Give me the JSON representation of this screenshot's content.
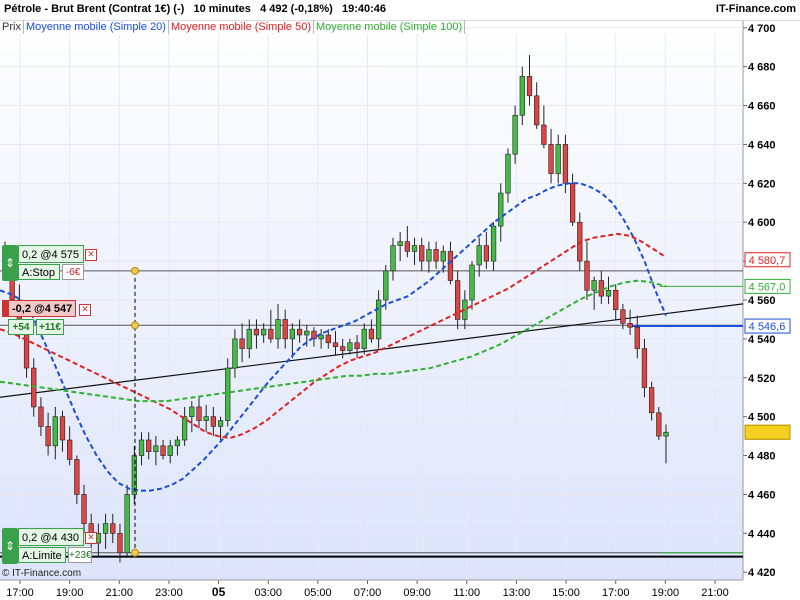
{
  "header": {
    "title": "Pétrole - Brut Brent (Contrat 1€) (-)   10 minutes   4 492 (-0,18%)   19:40:46",
    "brand": "IT-Finance.com"
  },
  "legend": [
    {
      "label": "Prix",
      "color": "#333333"
    },
    {
      "label": "Moyenne mobile (Simple 20)",
      "color": "#1a4fd8"
    },
    {
      "label": "Moyenne mobile (Simple 50)",
      "color": "#e02020"
    },
    {
      "label": "Moyenne mobile (Simple 100)",
      "color": "#30b030"
    }
  ],
  "footer": {
    "copyright": "© IT-Finance.com"
  },
  "orders": {
    "stop": {
      "line1": "0,2 @4 575",
      "line2": "A:Stop",
      "pnl": "-6€",
      "price": 4575
    },
    "position": {
      "line1": "-0,2 @4 547",
      "pnl1": "+54",
      "pnl2": "+11€",
      "price": 4547
    },
    "limit": {
      "line1": "0,2 @4 430",
      "line2": "A:Limite",
      "pnl": "+23€",
      "price": 4430
    }
  },
  "price_tags": [
    {
      "text": "4 580,7",
      "value": 4580.7,
      "color": "#e02020"
    },
    {
      "text": "4 567,0",
      "value": 4567.0,
      "color": "#30b030"
    },
    {
      "text": "4 546,6",
      "value": 4546.6,
      "color": "#1a4fd8"
    },
    {
      "text": "4 492",
      "value": 4492,
      "color": "#e8c000"
    }
  ],
  "colors": {
    "up": "#44bb44",
    "down": "#dd4444",
    "bg_top": "#ffffff",
    "bg_bottom": "#dde4fa"
  },
  "chart_data": {
    "type": "candlestick",
    "x_ticks": [
      "17:00",
      "19:00",
      "21:00",
      "23:00",
      "05",
      "03:00",
      "05:00",
      "07:00",
      "09:00",
      "11:00",
      "13:00",
      "15:00",
      "17:00",
      "19:00",
      "21:00"
    ],
    "y_ticks": [
      "4 420",
      "4 440",
      "4 460",
      "4 480",
      "4 500",
      "4 520",
      "4 540",
      "4 560",
      "4 580",
      "4 600",
      "4 620",
      "4 640",
      "4 660",
      "4 680",
      "4 700"
    ],
    "ylim": [
      4416,
      4704
    ],
    "y_tick_values": [
      4420,
      4440,
      4460,
      4480,
      4500,
      4520,
      4540,
      4560,
      4580,
      4600,
      4620,
      4640,
      4660,
      4680,
      4700
    ],
    "horizontal_lines": [
      4575,
      4547,
      4430,
      4428
    ],
    "trendlines": [
      [
        4510,
        4558
      ],
      [
        4547,
        4547
      ]
    ],
    "candles": [
      [
        4580,
        4590,
        4570,
        4575
      ],
      [
        4575,
        4578,
        4555,
        4560
      ],
      [
        4560,
        4568,
        4540,
        4545
      ],
      [
        4545,
        4550,
        4520,
        4525
      ],
      [
        4525,
        4530,
        4500,
        4505
      ],
      [
        4505,
        4510,
        4490,
        4495
      ],
      [
        4495,
        4502,
        4480,
        4485
      ],
      [
        4485,
        4505,
        4478,
        4500
      ],
      [
        4500,
        4503,
        4482,
        4488
      ],
      [
        4488,
        4495,
        4475,
        4478
      ],
      [
        4478,
        4480,
        4455,
        4460
      ],
      [
        4460,
        4465,
        4440,
        4445
      ],
      [
        4445,
        4450,
        4430,
        4435
      ],
      [
        4435,
        4445,
        4428,
        4440
      ],
      [
        4440,
        4450,
        4432,
        4445
      ],
      [
        4445,
        4450,
        4435,
        4440
      ],
      [
        4440,
        4445,
        4425,
        4430
      ],
      [
        4430,
        4465,
        4428,
        4460
      ],
      [
        4460,
        4485,
        4455,
        4480
      ],
      [
        4480,
        4492,
        4475,
        4488
      ],
      [
        4488,
        4492,
        4478,
        4482
      ],
      [
        4482,
        4490,
        4475,
        4485
      ],
      [
        4485,
        4488,
        4478,
        4480
      ],
      [
        4480,
        4488,
        4476,
        4485
      ],
      [
        4485,
        4490,
        4480,
        4488
      ],
      [
        4488,
        4505,
        4485,
        4500
      ],
      [
        4500,
        4508,
        4492,
        4505
      ],
      [
        4505,
        4510,
        4494,
        4498
      ],
      [
        4498,
        4506,
        4492,
        4500
      ],
      [
        4500,
        4505,
        4490,
        4495
      ],
      [
        4495,
        4500,
        4488,
        4498
      ],
      [
        4498,
        4530,
        4495,
        4525
      ],
      [
        4525,
        4545,
        4520,
        4540
      ],
      [
        4540,
        4548,
        4528,
        4535
      ],
      [
        4535,
        4550,
        4530,
        4545
      ],
      [
        4545,
        4550,
        4535,
        4542
      ],
      [
        4542,
        4548,
        4538,
        4545
      ],
      [
        4545,
        4555,
        4538,
        4540
      ],
      [
        4540,
        4558,
        4535,
        4550
      ],
      [
        4550,
        4555,
        4535,
        4540
      ],
      [
        4540,
        4548,
        4530,
        4545
      ],
      [
        4545,
        4550,
        4538,
        4542
      ],
      [
        4542,
        4547,
        4536,
        4544
      ],
      [
        4544,
        4546,
        4536,
        4540
      ],
      [
        4540,
        4545,
        4535,
        4542
      ],
      [
        4542,
        4545,
        4535,
        4538
      ],
      [
        4538,
        4544,
        4532,
        4536
      ],
      [
        4536,
        4540,
        4530,
        4534
      ],
      [
        4534,
        4540,
        4532,
        4538
      ],
      [
        4538,
        4542,
        4530,
        4535
      ],
      [
        4535,
        4548,
        4532,
        4545
      ],
      [
        4545,
        4550,
        4538,
        4540
      ],
      [
        4540,
        4565,
        4535,
        4560
      ],
      [
        4560,
        4578,
        4555,
        4575
      ],
      [
        4575,
        4592,
        4570,
        4588
      ],
      [
        4588,
        4595,
        4580,
        4590
      ],
      [
        4590,
        4598,
        4582,
        4585
      ],
      [
        4585,
        4592,
        4578,
        4588
      ],
      [
        4588,
        4592,
        4575,
        4580
      ],
      [
        4580,
        4590,
        4574,
        4586
      ],
      [
        4586,
        4590,
        4576,
        4580
      ],
      [
        4580,
        4588,
        4574,
        4585
      ],
      [
        4585,
        4590,
        4568,
        4570
      ],
      [
        4570,
        4575,
        4545,
        4550
      ],
      [
        4550,
        4565,
        4545,
        4560
      ],
      [
        4560,
        4580,
        4555,
        4578
      ],
      [
        4578,
        4592,
        4572,
        4588
      ],
      [
        4588,
        4595,
        4576,
        4580
      ],
      [
        4580,
        4600,
        4575,
        4598
      ],
      [
        4598,
        4620,
        4590,
        4615
      ],
      [
        4615,
        4638,
        4610,
        4635
      ],
      [
        4635,
        4660,
        4630,
        4655
      ],
      [
        4655,
        4680,
        4650,
        4675
      ],
      [
        4675,
        4686,
        4660,
        4665
      ],
      [
        4665,
        4672,
        4648,
        4650
      ],
      [
        4650,
        4660,
        4638,
        4640
      ],
      [
        4640,
        4648,
        4620,
        4625
      ],
      [
        4625,
        4645,
        4620,
        4640
      ],
      [
        4640,
        4645,
        4615,
        4620
      ],
      [
        4620,
        4625,
        4598,
        4600
      ],
      [
        4600,
        4605,
        4575,
        4580
      ],
      [
        4580,
        4590,
        4560,
        4565
      ],
      [
        4565,
        4572,
        4555,
        4570
      ],
      [
        4570,
        4575,
        4558,
        4562
      ],
      [
        4562,
        4572,
        4558,
        4565
      ],
      [
        4565,
        4568,
        4550,
        4555
      ],
      [
        4555,
        4558,
        4545,
        4548
      ],
      [
        4548,
        4555,
        4542,
        4546
      ],
      [
        4546,
        4552,
        4530,
        4535
      ],
      [
        4535,
        4540,
        4510,
        4515
      ],
      [
        4515,
        4518,
        4498,
        4502
      ],
      [
        4502,
        4505,
        4488,
        4490
      ],
      [
        4490,
        4496,
        4476,
        4492
      ]
    ],
    "series": [
      {
        "name": "Moyenne mobile (Simple 20)",
        "values": [
          4565,
          4563,
          4560,
          4552,
          4540,
          4528,
          4515,
          4502,
          4490,
          4480,
          4472,
          4466,
          4463,
          4462,
          4462,
          4463,
          4465,
          4468,
          4473,
          4478,
          4484,
          4490,
          4497,
          4504,
          4511,
          4518,
          4524,
          4530,
          4536,
          4540,
          4543,
          4545,
          4547,
          4549,
          4552,
          4555,
          4558,
          4560,
          4562,
          4566,
          4570,
          4575,
          4580,
          4585,
          4590,
          4595,
          4600,
          4604,
          4608,
          4612,
          4614,
          4617,
          4619,
          4620,
          4620,
          4618,
          4615,
          4610,
          4602,
          4592,
          4580,
          4565,
          4552
        ]
      },
      {
        "name": "Moyenne mobile (Simple 50)",
        "values": [
          4545,
          4543,
          4540,
          4537,
          4534,
          4531,
          4528,
          4525,
          4522,
          4519,
          4516,
          4513,
          4510,
          4507,
          4504,
          4500,
          4496,
          4492,
          4490,
          4489,
          4491,
          4494,
          4498,
          4503,
          4508,
          4513,
          4518,
          4522,
          4526,
          4529,
          4531,
          4533,
          4536,
          4539,
          4542,
          4545,
          4548,
          4551,
          4554,
          4557,
          4560,
          4563,
          4566,
          4570,
          4574,
          4578,
          4582,
          4586,
          4590,
          4592,
          4593,
          4594,
          4593,
          4590,
          4586,
          4582
        ]
      },
      {
        "name": "Moyenne mobile (Simple 100)",
        "values": [
          4518,
          4517,
          4516,
          4515,
          4514,
          4513,
          4512,
          4511,
          4510,
          4509,
          4508,
          4508,
          4508,
          4509,
          4510,
          4511,
          4512,
          4513,
          4514,
          4515,
          4516,
          4517,
          4518,
          4519,
          4520,
          4521,
          4521,
          4522,
          4522,
          4523,
          4524,
          4525,
          4527,
          4529,
          4531,
          4534,
          4537,
          4541,
          4545,
          4549,
          4553,
          4557,
          4561,
          4564,
          4567,
          4569,
          4570,
          4569,
          4567
        ]
      }
    ]
  }
}
